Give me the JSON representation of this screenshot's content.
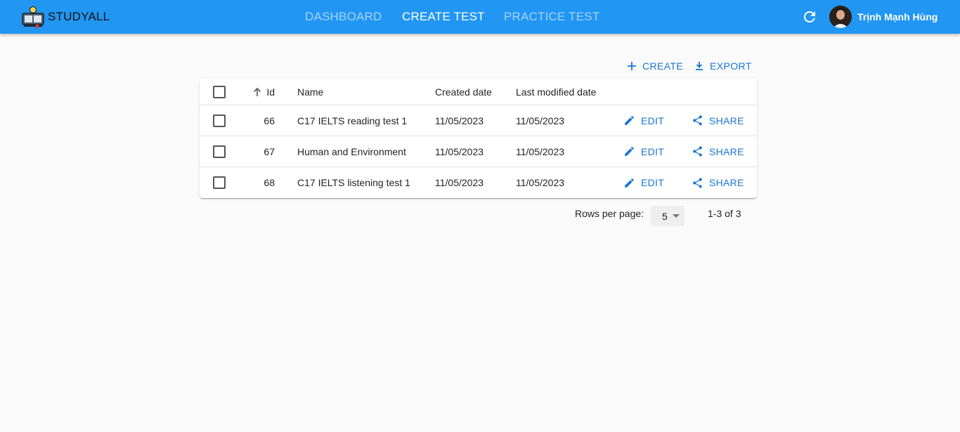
{
  "app": {
    "name": "STUDYALL"
  },
  "nav": {
    "items": [
      {
        "label": "DASHBOARD"
      },
      {
        "label": "CREATE TEST"
      },
      {
        "label": "PRACTICE TEST"
      }
    ]
  },
  "user": {
    "name": "Trịnh Mạnh Hùng"
  },
  "toolbar": {
    "create_label": "CREATE",
    "export_label": "EXPORT"
  },
  "grid": {
    "columns": {
      "id": "Id",
      "name": "Name",
      "created": "Created date",
      "modified": "Last modified date"
    },
    "rows": [
      {
        "id": "66",
        "name": "C17 IELTS reading test 1",
        "created": "11/05/2023",
        "modified": "11/05/2023",
        "edit": "EDIT",
        "share": "SHARE"
      },
      {
        "id": "67",
        "name": "Human and Environment",
        "created": "11/05/2023",
        "modified": "11/05/2023",
        "edit": "EDIT",
        "share": "SHARE"
      },
      {
        "id": "68",
        "name": "C17 IELTS listening test 1",
        "created": "11/05/2023",
        "modified": "11/05/2023",
        "edit": "EDIT",
        "share": "SHARE"
      }
    ]
  },
  "pagination": {
    "rows_per_page_label": "Rows per page:",
    "rows_per_page": "5",
    "range": "1-3 of 3"
  },
  "colors": {
    "primary": "#2196f3",
    "action": "#1976d2",
    "background": "#fafafa"
  },
  "icons": {
    "refresh": "refresh-icon",
    "add": "plus-icon",
    "export": "download-icon",
    "sort": "arrow-up-icon",
    "edit": "pencil-icon",
    "share": "share-icon",
    "dropdown": "caret-down-icon"
  }
}
